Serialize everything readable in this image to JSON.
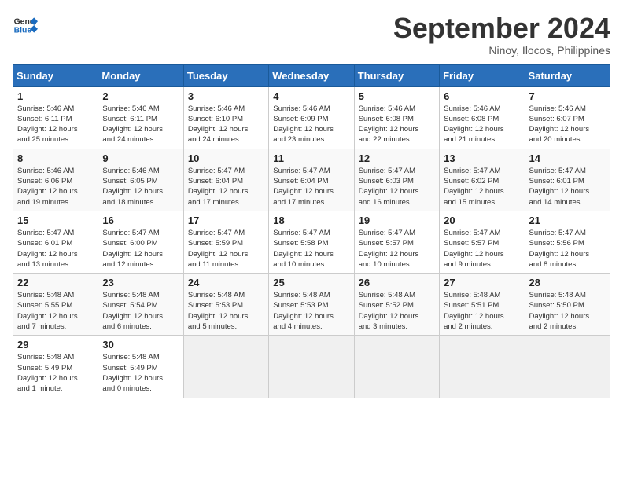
{
  "logo": {
    "line1": "General",
    "line2": "Blue"
  },
  "title": "September 2024",
  "subtitle": "Ninoy, Ilocos, Philippines",
  "weekdays": [
    "Sunday",
    "Monday",
    "Tuesday",
    "Wednesday",
    "Thursday",
    "Friday",
    "Saturday"
  ],
  "weeks": [
    [
      {
        "day": "1",
        "info": "Sunrise: 5:46 AM\nSunset: 6:11 PM\nDaylight: 12 hours\nand 25 minutes."
      },
      {
        "day": "2",
        "info": "Sunrise: 5:46 AM\nSunset: 6:11 PM\nDaylight: 12 hours\nand 24 minutes."
      },
      {
        "day": "3",
        "info": "Sunrise: 5:46 AM\nSunset: 6:10 PM\nDaylight: 12 hours\nand 24 minutes."
      },
      {
        "day": "4",
        "info": "Sunrise: 5:46 AM\nSunset: 6:09 PM\nDaylight: 12 hours\nand 23 minutes."
      },
      {
        "day": "5",
        "info": "Sunrise: 5:46 AM\nSunset: 6:08 PM\nDaylight: 12 hours\nand 22 minutes."
      },
      {
        "day": "6",
        "info": "Sunrise: 5:46 AM\nSunset: 6:08 PM\nDaylight: 12 hours\nand 21 minutes."
      },
      {
        "day": "7",
        "info": "Sunrise: 5:46 AM\nSunset: 6:07 PM\nDaylight: 12 hours\nand 20 minutes."
      }
    ],
    [
      {
        "day": "8",
        "info": "Sunrise: 5:46 AM\nSunset: 6:06 PM\nDaylight: 12 hours\nand 19 minutes."
      },
      {
        "day": "9",
        "info": "Sunrise: 5:46 AM\nSunset: 6:05 PM\nDaylight: 12 hours\nand 18 minutes."
      },
      {
        "day": "10",
        "info": "Sunrise: 5:47 AM\nSunset: 6:04 PM\nDaylight: 12 hours\nand 17 minutes."
      },
      {
        "day": "11",
        "info": "Sunrise: 5:47 AM\nSunset: 6:04 PM\nDaylight: 12 hours\nand 17 minutes."
      },
      {
        "day": "12",
        "info": "Sunrise: 5:47 AM\nSunset: 6:03 PM\nDaylight: 12 hours\nand 16 minutes."
      },
      {
        "day": "13",
        "info": "Sunrise: 5:47 AM\nSunset: 6:02 PM\nDaylight: 12 hours\nand 15 minutes."
      },
      {
        "day": "14",
        "info": "Sunrise: 5:47 AM\nSunset: 6:01 PM\nDaylight: 12 hours\nand 14 minutes."
      }
    ],
    [
      {
        "day": "15",
        "info": "Sunrise: 5:47 AM\nSunset: 6:01 PM\nDaylight: 12 hours\nand 13 minutes."
      },
      {
        "day": "16",
        "info": "Sunrise: 5:47 AM\nSunset: 6:00 PM\nDaylight: 12 hours\nand 12 minutes."
      },
      {
        "day": "17",
        "info": "Sunrise: 5:47 AM\nSunset: 5:59 PM\nDaylight: 12 hours\nand 11 minutes."
      },
      {
        "day": "18",
        "info": "Sunrise: 5:47 AM\nSunset: 5:58 PM\nDaylight: 12 hours\nand 10 minutes."
      },
      {
        "day": "19",
        "info": "Sunrise: 5:47 AM\nSunset: 5:57 PM\nDaylight: 12 hours\nand 10 minutes."
      },
      {
        "day": "20",
        "info": "Sunrise: 5:47 AM\nSunset: 5:57 PM\nDaylight: 12 hours\nand 9 minutes."
      },
      {
        "day": "21",
        "info": "Sunrise: 5:47 AM\nSunset: 5:56 PM\nDaylight: 12 hours\nand 8 minutes."
      }
    ],
    [
      {
        "day": "22",
        "info": "Sunrise: 5:48 AM\nSunset: 5:55 PM\nDaylight: 12 hours\nand 7 minutes."
      },
      {
        "day": "23",
        "info": "Sunrise: 5:48 AM\nSunset: 5:54 PM\nDaylight: 12 hours\nand 6 minutes."
      },
      {
        "day": "24",
        "info": "Sunrise: 5:48 AM\nSunset: 5:53 PM\nDaylight: 12 hours\nand 5 minutes."
      },
      {
        "day": "25",
        "info": "Sunrise: 5:48 AM\nSunset: 5:53 PM\nDaylight: 12 hours\nand 4 minutes."
      },
      {
        "day": "26",
        "info": "Sunrise: 5:48 AM\nSunset: 5:52 PM\nDaylight: 12 hours\nand 3 minutes."
      },
      {
        "day": "27",
        "info": "Sunrise: 5:48 AM\nSunset: 5:51 PM\nDaylight: 12 hours\nand 2 minutes."
      },
      {
        "day": "28",
        "info": "Sunrise: 5:48 AM\nSunset: 5:50 PM\nDaylight: 12 hours\nand 2 minutes."
      }
    ],
    [
      {
        "day": "29",
        "info": "Sunrise: 5:48 AM\nSunset: 5:49 PM\nDaylight: 12 hours\nand 1 minute."
      },
      {
        "day": "30",
        "info": "Sunrise: 5:48 AM\nSunset: 5:49 PM\nDaylight: 12 hours\nand 0 minutes."
      },
      {
        "day": "",
        "info": ""
      },
      {
        "day": "",
        "info": ""
      },
      {
        "day": "",
        "info": ""
      },
      {
        "day": "",
        "info": ""
      },
      {
        "day": "",
        "info": ""
      }
    ]
  ]
}
